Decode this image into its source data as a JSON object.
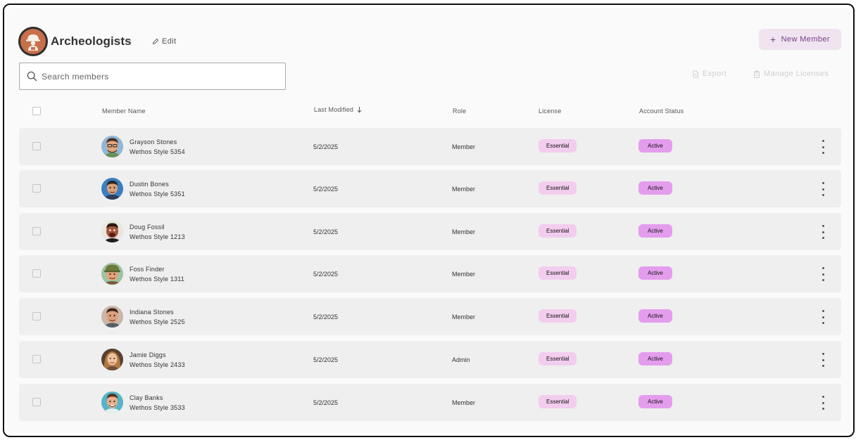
{
  "team": {
    "title": "Archeologists",
    "edit_label": "Edit"
  },
  "actions": {
    "new_member_label": "New Member",
    "export_label": "Export",
    "manage_licenses_label": "Manage Licenses"
  },
  "search": {
    "placeholder": "Search members",
    "value": ""
  },
  "table": {
    "columns": {
      "member_name": "Member Name",
      "last_modified": "Last Modified",
      "role": "Role",
      "license": "License",
      "account_status": "Account Status"
    },
    "sort": {
      "column": "last_modified",
      "direction": "descending"
    },
    "rows": [
      {
        "name": "Grayson Stones",
        "style": "Wethos Style 5354",
        "last_modified": "5/2/2025",
        "role": "Member",
        "license": "Essential",
        "status": "Active"
      },
      {
        "name": "Dustin Bones",
        "style": "Wethos Style 5351",
        "last_modified": "5/2/2025",
        "role": "Member",
        "license": "Essential",
        "status": "Active"
      },
      {
        "name": "Doug Fossil",
        "style": "Wethos Style 1213",
        "last_modified": "5/2/2025",
        "role": "Member",
        "license": "Essential",
        "status": "Active"
      },
      {
        "name": "Foss Finder",
        "style": "Wethos Style 1311",
        "last_modified": "5/2/2025",
        "role": "Member",
        "license": "Essential",
        "status": "Active"
      },
      {
        "name": "Indiana Stones",
        "style": "Wethos Style 2525",
        "last_modified": "5/2/2025",
        "role": "Member",
        "license": "Essential",
        "status": "Active"
      },
      {
        "name": "Jamie Diggs",
        "style": "Wethos Style 2433",
        "last_modified": "5/2/2025",
        "role": "Admin",
        "license": "Essential",
        "status": "Active"
      },
      {
        "name": "Clay Banks",
        "style": "Wethos Style 3533",
        "last_modified": "5/2/2025",
        "role": "Member",
        "license": "Essential",
        "status": "Active"
      }
    ]
  },
  "colors": {
    "accent": "#7a3f86",
    "license_badge": "#f3cdee",
    "status_badge": "#e49ded",
    "row_background": "#efefef"
  },
  "icons": {
    "team": "archeologist-icon",
    "edit": "pencil-icon",
    "new_member": "plus-icon",
    "search": "search-icon",
    "export": "file-icon",
    "manage_licenses": "clipboard-icon",
    "sort": "arrow-down-icon",
    "row_menu": "kebab-menu-icon"
  }
}
